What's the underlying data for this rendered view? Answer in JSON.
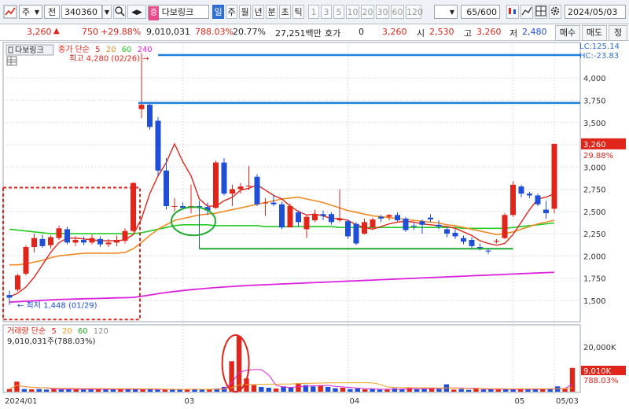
{
  "toolbar": {
    "market": "주",
    "order_type": "전",
    "code": "340360",
    "stock_tag": "증",
    "stock_name": "다보링크",
    "periods": [
      "일",
      "주",
      "월",
      "년",
      "분",
      "초",
      "틱"
    ],
    "active_period": "일",
    "intervals": [
      "1",
      "3",
      "5",
      "10",
      "20",
      "30",
      "60",
      "120"
    ],
    "count": "65",
    "count_max": "/600",
    "date": "2024/05/03"
  },
  "quote": {
    "price": "3,260",
    "change": "750",
    "change_pct": "+29.88%",
    "volume": "9,010,031",
    "volume_ratio": "788.03%",
    "turnover": "20.77%",
    "amount": "27,251백만",
    "hoga_label": "호가",
    "hoga_value": "0",
    "current": "3,260",
    "open_label": "시",
    "open": "2,530",
    "high_label": "고",
    "high": "3,260",
    "low_label": "저",
    "low": "2,480",
    "buy_button": "매수",
    "sell_button": "매도",
    "edit_button": "정"
  },
  "price_panel": {
    "chip": "다보링크",
    "legend_prefix": "종가 단순",
    "ma_periods": [
      "5",
      "20",
      "60",
      "240"
    ],
    "lc_label": "LC:125.14",
    "hc_label": "HC:-23.83",
    "max_label": "최고 4,280 (02/26)",
    "min_label": "최저 1,448 (01/29)",
    "last_price": "3,260",
    "last_pct": "29.88%"
  },
  "volume_panel": {
    "legend_prefix": "거래량 단순",
    "ma_periods": [
      "5",
      "20",
      "60",
      "120"
    ],
    "summary": "9,010,031주(788.03%)",
    "last_volume": "9,010K",
    "last_pct": "788.03%",
    "axis_label": "20,000K"
  },
  "colors": {
    "up": "#e0251b",
    "down": "#1f4fd6",
    "ma5": "#e0251b",
    "ma20": "#f08a24",
    "ma60": "#22cc22",
    "ma240": "#dd22dd",
    "hline": "#1e7fe0"
  },
  "chart_data": {
    "type": "candlestick",
    "y_ticks": [
      1500,
      1750,
      2000,
      2250,
      2500,
      2750,
      3000,
      3250,
      3500,
      3750,
      4000
    ],
    "y_tick_labels": [
      "1,500",
      "1,750",
      "2,000",
      "2,250",
      "2,500",
      "2,750",
      "3,000",
      "3,250",
      "3,500",
      "3,750",
      "4,000"
    ],
    "ylim": [
      1260,
      4400
    ],
    "x_labels": [
      {
        "i": 0,
        "label": "2024/01"
      },
      {
        "i": 21,
        "label": "03"
      },
      {
        "i": 41,
        "label": "04"
      },
      {
        "i": 61,
        "label": "05"
      },
      {
        "i": 66,
        "label": "05/03"
      }
    ],
    "candles": [
      {
        "o": 1560,
        "h": 1610,
        "l": 1448,
        "c": 1530
      },
      {
        "o": 1620,
        "h": 1800,
        "l": 1600,
        "c": 1780
      },
      {
        "o": 1800,
        "h": 2120,
        "l": 1780,
        "c": 2100
      },
      {
        "o": 2100,
        "h": 2250,
        "l": 2040,
        "c": 2200
      },
      {
        "o": 2190,
        "h": 2240,
        "l": 2090,
        "c": 2110
      },
      {
        "o": 2120,
        "h": 2230,
        "l": 2080,
        "c": 2210
      },
      {
        "o": 2200,
        "h": 2340,
        "l": 2180,
        "c": 2310
      },
      {
        "o": 2300,
        "h": 2330,
        "l": 2130,
        "c": 2150
      },
      {
        "o": 2150,
        "h": 2220,
        "l": 2110,
        "c": 2180
      },
      {
        "o": 2180,
        "h": 2220,
        "l": 2120,
        "c": 2150
      },
      {
        "o": 2150,
        "h": 2240,
        "l": 2130,
        "c": 2200
      },
      {
        "o": 2190,
        "h": 2220,
        "l": 2100,
        "c": 2130
      },
      {
        "o": 2130,
        "h": 2190,
        "l": 2100,
        "c": 2150
      },
      {
        "o": 2150,
        "h": 2230,
        "l": 2110,
        "c": 2180
      },
      {
        "o": 2170,
        "h": 2310,
        "l": 2140,
        "c": 2280
      },
      {
        "o": 2280,
        "h": 2830,
        "l": 2270,
        "c": 2820
      },
      {
        "o": 3650,
        "h": 4280,
        "l": 3550,
        "c": 3700
      },
      {
        "o": 3700,
        "h": 3730,
        "l": 3420,
        "c": 3450
      },
      {
        "o": 3520,
        "h": 3560,
        "l": 2900,
        "c": 2960
      },
      {
        "o": 2960,
        "h": 3100,
        "l": 2520,
        "c": 2560
      },
      {
        "o": 2560,
        "h": 2650,
        "l": 2500,
        "c": 2560
      },
      {
        "o": 2560,
        "h": 2600,
        "l": 2520,
        "c": 2540
      },
      {
        "o": 2540,
        "h": 2800,
        "l": 2480,
        "c": 2560
      },
      {
        "o": 2560,
        "h": 2620,
        "l": 2080,
        "c": 2550
      },
      {
        "o": 2550,
        "h": 2600,
        "l": 2460,
        "c": 2510
      },
      {
        "o": 2540,
        "h": 3070,
        "l": 2530,
        "c": 3050
      },
      {
        "o": 3050,
        "h": 3100,
        "l": 2680,
        "c": 2700
      },
      {
        "o": 2700,
        "h": 2800,
        "l": 2560,
        "c": 2750
      },
      {
        "o": 2750,
        "h": 2820,
        "l": 2700,
        "c": 2780
      },
      {
        "o": 2780,
        "h": 3010,
        "l": 2740,
        "c": 2790
      },
      {
        "o": 2890,
        "h": 2920,
        "l": 2560,
        "c": 2580
      },
      {
        "o": 2590,
        "h": 2650,
        "l": 2450,
        "c": 2600
      },
      {
        "o": 2600,
        "h": 2690,
        "l": 2560,
        "c": 2580
      },
      {
        "o": 2580,
        "h": 2610,
        "l": 2300,
        "c": 2320
      },
      {
        "o": 2320,
        "h": 2590,
        "l": 2320,
        "c": 2560
      },
      {
        "o": 2490,
        "h": 2510,
        "l": 2330,
        "c": 2380
      },
      {
        "o": 2300,
        "h": 2460,
        "l": 2200,
        "c": 2440
      },
      {
        "o": 2400,
        "h": 2520,
        "l": 2380,
        "c": 2470
      },
      {
        "o": 2470,
        "h": 2510,
        "l": 2400,
        "c": 2450
      },
      {
        "o": 2470,
        "h": 2490,
        "l": 2350,
        "c": 2380
      },
      {
        "o": 2400,
        "h": 2750,
        "l": 2380,
        "c": 2420
      },
      {
        "o": 2390,
        "h": 2410,
        "l": 2190,
        "c": 2220
      },
      {
        "o": 2360,
        "h": 2380,
        "l": 2120,
        "c": 2140
      },
      {
        "o": 2250,
        "h": 2420,
        "l": 2240,
        "c": 2380
      },
      {
        "o": 2320,
        "h": 2430,
        "l": 2300,
        "c": 2410
      },
      {
        "o": 2440,
        "h": 2460,
        "l": 2380,
        "c": 2420
      },
      {
        "o": 2440,
        "h": 2470,
        "l": 2400,
        "c": 2460
      },
      {
        "o": 2460,
        "h": 2490,
        "l": 2390,
        "c": 2400
      },
      {
        "o": 2420,
        "h": 2440,
        "l": 2270,
        "c": 2290
      },
      {
        "o": 2340,
        "h": 2370,
        "l": 2290,
        "c": 2330
      },
      {
        "o": 2390,
        "h": 2410,
        "l": 2250,
        "c": 2350
      },
      {
        "o": 2430,
        "h": 2470,
        "l": 2380,
        "c": 2410
      },
      {
        "o": 2350,
        "h": 2400,
        "l": 2300,
        "c": 2330
      },
      {
        "o": 2300,
        "h": 2330,
        "l": 2210,
        "c": 2250
      },
      {
        "o": 2260,
        "h": 2300,
        "l": 2190,
        "c": 2220
      },
      {
        "o": 2200,
        "h": 2230,
        "l": 2130,
        "c": 2160
      },
      {
        "o": 2180,
        "h": 2210,
        "l": 2070,
        "c": 2110
      },
      {
        "o": 2100,
        "h": 2140,
        "l": 2060,
        "c": 2080
      },
      {
        "o": 2060,
        "h": 2090,
        "l": 2020,
        "c": 2050
      },
      {
        "o": 2160,
        "h": 2190,
        "l": 2140,
        "c": 2170
      },
      {
        "o": 2200,
        "h": 2480,
        "l": 2190,
        "c": 2460
      },
      {
        "o": 2460,
        "h": 2840,
        "l": 2440,
        "c": 2800
      },
      {
        "o": 2780,
        "h": 2800,
        "l": 2660,
        "c": 2700
      },
      {
        "o": 2700,
        "h": 2720,
        "l": 2650,
        "c": 2680
      },
      {
        "o": 2680,
        "h": 2700,
        "l": 2560,
        "c": 2580
      },
      {
        "o": 2520,
        "h": 2620,
        "l": 2420,
        "c": 2480
      },
      {
        "o": 2530,
        "h": 3260,
        "l": 2480,
        "c": 3260
      }
    ],
    "ma5": [
      1540,
      1580,
      1650,
      1760,
      1900,
      2040,
      2150,
      2200,
      2200,
      2190,
      2180,
      2170,
      2170,
      2170,
      2180,
      2240,
      2420,
      2700,
      2900,
      3050,
      3260,
      3060,
      2900,
      2640,
      2560,
      2560,
      2620,
      2660,
      2740,
      2760,
      2800,
      2740,
      2680,
      2640,
      2560,
      2500,
      2460,
      2470,
      2450,
      2420,
      2420,
      2400,
      2350,
      2320,
      2300,
      2330,
      2360,
      2380,
      2390,
      2380,
      2360,
      2350,
      2340,
      2330,
      2310,
      2270,
      2230,
      2170,
      2140,
      2120,
      2140,
      2240,
      2380,
      2520,
      2640,
      2660,
      2700
    ],
    "ma20": [
      1900,
      1900,
      1910,
      1930,
      1950,
      1980,
      2000,
      2010,
      2020,
      2030,
      2030,
      2030,
      2030,
      2030,
      2040,
      2080,
      2150,
      2230,
      2300,
      2350,
      2400,
      2420,
      2440,
      2460,
      2470,
      2480,
      2500,
      2520,
      2540,
      2560,
      2580,
      2600,
      2620,
      2640,
      2650,
      2660,
      2640,
      2620,
      2600,
      2570,
      2540,
      2510,
      2490,
      2470,
      2450,
      2440,
      2430,
      2420,
      2410,
      2400,
      2390,
      2380,
      2370,
      2350,
      2340,
      2320,
      2300,
      2280,
      2260,
      2240,
      2250,
      2270,
      2300,
      2330,
      2360,
      2380,
      2400
    ],
    "ma60": [
      2300,
      2290,
      2280,
      2270,
      2260,
      2250,
      2250,
      2250,
      2250,
      2250,
      2250,
      2250,
      2250,
      2250,
      2250,
      2250,
      2260,
      2280,
      2300,
      2320,
      2340,
      2350,
      2350,
      2350,
      2350,
      2340,
      2340,
      2340,
      2340,
      2340,
      2340,
      2330,
      2330,
      2330,
      2330,
      2330,
      2330,
      2330,
      2330,
      2330,
      2320,
      2320,
      2320,
      2320,
      2320,
      2320,
      2320,
      2320,
      2320,
      2320,
      2320,
      2320,
      2320,
      2320,
      2320,
      2310,
      2310,
      2310,
      2310,
      2310,
      2310,
      2320,
      2330,
      2340,
      2350,
      2360,
      2370
    ],
    "ma240": [
      1480,
      1485,
      1490,
      1495,
      1500,
      1505,
      1510,
      1512,
      1515,
      1518,
      1520,
      1522,
      1525,
      1528,
      1530,
      1533,
      1545,
      1560,
      1575,
      1588,
      1600,
      1610,
      1620,
      1628,
      1636,
      1644,
      1650,
      1656,
      1662,
      1668,
      1672,
      1676,
      1680,
      1684,
      1688,
      1692,
      1696,
      1700,
      1704,
      1708,
      1712,
      1716,
      1720,
      1724,
      1728,
      1732,
      1736,
      1740,
      1744,
      1748,
      1752,
      1756,
      1760,
      1764,
      1768,
      1772,
      1776,
      1780,
      1784,
      1788,
      1792,
      1796,
      1800,
      1804,
      1808,
      1812,
      1815
    ],
    "volumes": [
      1.0,
      3.8,
      1.0,
      0.9,
      1.0,
      0.8,
      1.1,
      0.9,
      1.0,
      0.9,
      0.8,
      0.9,
      1.0,
      0.8,
      0.9,
      1.0,
      0.9,
      1.1,
      0.8,
      0.9,
      0.7,
      0.9,
      1.0,
      0.8,
      0.9,
      1.0,
      0.8,
      1.0,
      1.2,
      1.8,
      11.5,
      21.0,
      5.0,
      2.5,
      1.8,
      1.5,
      1.2,
      2.0,
      1.5,
      3.2,
      2.5,
      2.0,
      2.4,
      1.8,
      1.3,
      1.5,
      1.0,
      1.2,
      0.9,
      1.0,
      0.8,
      0.8,
      1.3,
      0.9,
      1.6,
      0.9,
      1.0,
      1.4,
      1.0,
      2.8,
      0.8,
      1.0,
      0.7,
      1.4,
      0.8,
      0.9,
      0.8,
      1.0,
      0.9,
      1.1,
      0.8,
      0.9,
      1.2,
      1.0,
      2.0,
      1.0,
      9.0
    ]
  }
}
